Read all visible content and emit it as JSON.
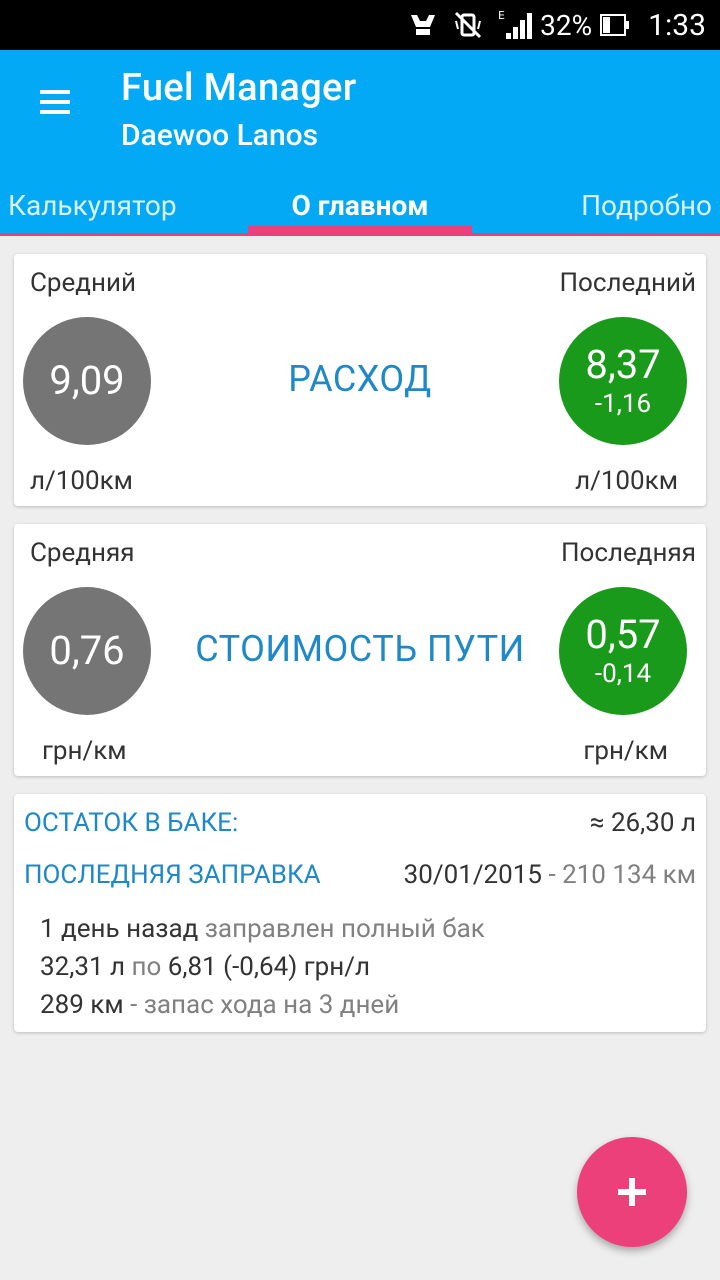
{
  "status_bar": {
    "network_type": "E",
    "battery": "32%",
    "time": "1:33"
  },
  "app_bar": {
    "title": "Fuel Manager",
    "subtitle": "Daewoo Lanos",
    "tabs": [
      {
        "label": "Калькулятор",
        "selected": false
      },
      {
        "label": "О главном",
        "selected": true
      },
      {
        "label": "Подробно",
        "selected": false
      }
    ]
  },
  "consumption_card": {
    "left_label": "Средний",
    "right_label": "Последний",
    "title": "РАСХОД",
    "average_value": "9,09",
    "last_value": "8,37",
    "last_delta": "-1,16",
    "unit_left": "л/100км",
    "unit_right": "л/100км"
  },
  "trip_cost_card": {
    "left_label": "Средняя",
    "right_label": "Последняя",
    "title": "СТОИМОСТЬ ПУТИ",
    "average_value": "0,76",
    "last_value": "0,57",
    "last_delta": "-0,14",
    "unit_left": "грн/км",
    "unit_right": "грн/км"
  },
  "tank_card": {
    "tank_label": "ОСТАТОК В БАКЕ:",
    "tank_value": "≈ 26,30 л",
    "refuel_label": "ПОСЛЕДНЯЯ ЗАПРАВКА",
    "refuel_date": "30/01/2015",
    "refuel_odometer": " - 210 134 км",
    "line1_strong": "1 день назад",
    "line1_rest": " заправлен полный бак",
    "line2_volume": "32,31 л",
    "line2_by": " по ",
    "line2_price": "6,81 (-0,64) грн/л",
    "line3_distance": "289 км",
    "line3_rest": " - запас хода на 3 дней"
  },
  "fab": {
    "icon": "plus-icon"
  },
  "colors": {
    "primary": "#03a9f4",
    "accent": "#ec407a",
    "green": "#1a9a1a",
    "grey_circle": "#757575",
    "link_blue": "#1e88c8"
  }
}
